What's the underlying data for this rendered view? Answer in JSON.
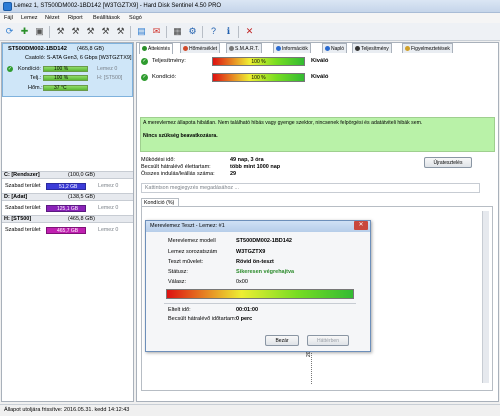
{
  "window": {
    "title": "Lemez 1, ST500DM002-1BD142 [W3TGZTX9] - Hard Disk Sentinel 4.50 PRO"
  },
  "menu": [
    "Fájl",
    "Lemez",
    "Nézet",
    "Riport",
    "Beállítások",
    "Súgó"
  ],
  "disk": {
    "name": "ST500DM002-1BD142",
    "size": "(465,8 GB)",
    "connection": "Csatoló: S-ATA Gen3, 6 Gbps [W3TGZTX9]",
    "health_label": "Kondíció:",
    "health_value": "100 %",
    "health_level": 100,
    "health_drive": "Lemez 0",
    "perf_label": "Telj.:",
    "perf_value": "100 %",
    "perf_level": 100,
    "perf_drive": "H: [ST500]",
    "temp_label": "Hőm.:",
    "temp_value": "37 °C"
  },
  "partitions": [
    {
      "name": "C: [Rendszer]",
      "size": "(100,0 GB)",
      "free_label": "Szabad terület",
      "free_value": "51,2 GB",
      "free_fraction": 0.51,
      "drive": "Lemez 0",
      "color": "#3c3cd8"
    },
    {
      "name": "D: [Adat]",
      "size": "(138,5 GB)",
      "free_label": "Szabad terület",
      "free_value": "125,1 GB",
      "free_fraction": 0.9,
      "drive": "Lemez 0",
      "color": "#8a22b8"
    },
    {
      "name": "H: [ST500]",
      "size": "(465,8 GB)",
      "free_label": "Szabad terület",
      "free_value": "465,7 GB",
      "free_fraction": 1.0,
      "drive": "Lemez 0",
      "color": "#c020b0"
    }
  ],
  "tabs": [
    "Áttekintés",
    "Hőmérséklet",
    "S.M.A.R.T.",
    "Információk",
    "Napló",
    "Teljesítmény",
    "Figyelmeztetések"
  ],
  "overview": {
    "perf_label": "Teljesítmény:",
    "perf_value": "100 %",
    "perf_level": 100,
    "perf_status": "Kiváló",
    "health_label": "Kondíció:",
    "health_value": "100 %",
    "health_level": 100,
    "health_status": "Kiváló",
    "message": "A merevlemez állapota hibátlan. Nem található hibás vagy gyenge szektor, nincsenek felpörgési és adatátviteli hibák sem.",
    "action": "Nincs szükség beavatkozásra.",
    "uptime_label": "Működési idő:",
    "uptime_value": "49 nap, 3 óra",
    "remaining_label": "Becsült hátralévő élettartam:",
    "remaining_value": "több mint 1000 nap",
    "startstop_label": "Összes indulás/leállás száma:",
    "startstop_value": "29",
    "retest_button": "Újratesztelés",
    "comment_placeholder": "Kattintson megjegyzés megadásához ...",
    "graph_tab": "Kondíció (%)",
    "graph_date": "2016.05"
  },
  "dialog": {
    "title": "Merevlemez Teszt - Lemez: #1",
    "rows": [
      {
        "label": "Merevlemez modell",
        "value": "ST500DM002-1BD142"
      },
      {
        "label": "Lemez sorozatszám",
        "value": "W3TGZTX9"
      },
      {
        "label": "Teszt művelet:",
        "value": "Rövid ön-teszt"
      },
      {
        "label": "Státusz:",
        "value": "Sikeresen végrehajtva"
      },
      {
        "label": "Válasz:",
        "value": "0x00"
      }
    ],
    "elapsed_label": "Eltelt idő:",
    "elapsed_value": "00:01:00",
    "remaining_label": "Becsült hátralévő időtartam:",
    "remaining_value": "0 perc",
    "close_button": "Bezár",
    "background_button": "Háttérben"
  },
  "statusbar": {
    "text": "Állapot utoljára frissítve: 2016.05.31. kedd 14:12:43"
  },
  "colors": {
    "selected_disk_bg": "#cfe6f8",
    "status_ok": "#2f9c2f",
    "message_bg": "#b9f2a8"
  }
}
